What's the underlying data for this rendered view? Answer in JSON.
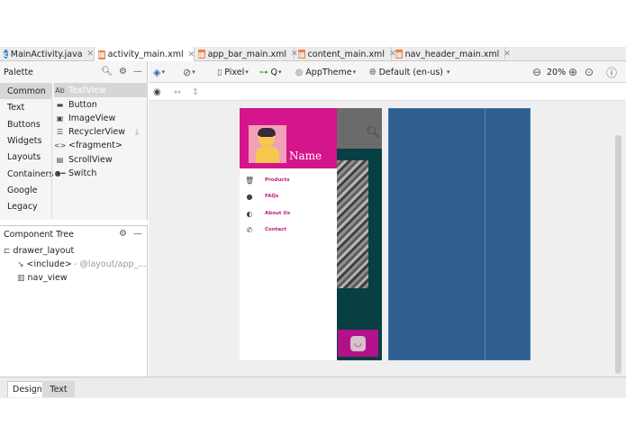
{
  "editor_tabs": [
    {
      "label": "MainActivity.java",
      "icon": "java-class-icon",
      "active": false
    },
    {
      "label": "activity_main.xml",
      "icon": "xml-layout-icon",
      "active": true
    },
    {
      "label": "app_bar_main.xml",
      "icon": "xml-layout-icon",
      "active": false
    },
    {
      "label": "content_main.xml",
      "icon": "xml-layout-icon",
      "active": false
    },
    {
      "label": "nav_header_main.xml",
      "icon": "xml-layout-icon",
      "active": false
    }
  ],
  "palette": {
    "title": "Palette",
    "categories": [
      "Common",
      "Text",
      "Buttons",
      "Widgets",
      "Layouts",
      "Containers",
      "Google",
      "Legacy"
    ],
    "selected_category": "Common",
    "widgets": [
      {
        "label": "TextView",
        "icon_text": "Ab"
      },
      {
        "label": "Button",
        "icon_text": "▬"
      },
      {
        "label": "ImageView",
        "icon_text": "▣"
      },
      {
        "label": "RecyclerView",
        "icon_text": "☰"
      },
      {
        "label": "<fragment>",
        "icon_text": "<>"
      },
      {
        "label": "ScrollView",
        "icon_text": "▤"
      },
      {
        "label": "Switch",
        "icon_text": "●━"
      }
    ]
  },
  "component_tree": {
    "title": "Component Tree",
    "nodes": [
      {
        "label": "drawer_layout",
        "hint": ""
      },
      {
        "label": "<include>",
        "hint": "- @layout/app_..."
      },
      {
        "label": "nav_view",
        "hint": ""
      }
    ]
  },
  "toolbar": {
    "device": "Pixel",
    "api": "Q",
    "theme": "AppTheme",
    "locale": "Default (en-us)",
    "zoom": "20%"
  },
  "preview": {
    "nav_header_name": "Name",
    "menu_items": [
      {
        "label": "Products",
        "icon": "trash-icon"
      },
      {
        "label": "FAQs",
        "icon": "help-icon"
      },
      {
        "label": "About Us",
        "icon": "info-icon"
      },
      {
        "label": "Contact",
        "icon": "phone-icon"
      }
    ]
  },
  "bottom_tabs": [
    "Design",
    "Text"
  ],
  "colors": {
    "nav_header": "#d5158c",
    "menu_text": "#c2187f",
    "fab": "#b3118a",
    "blueprint": "#2f5f8f",
    "app_background": "#073f43"
  }
}
